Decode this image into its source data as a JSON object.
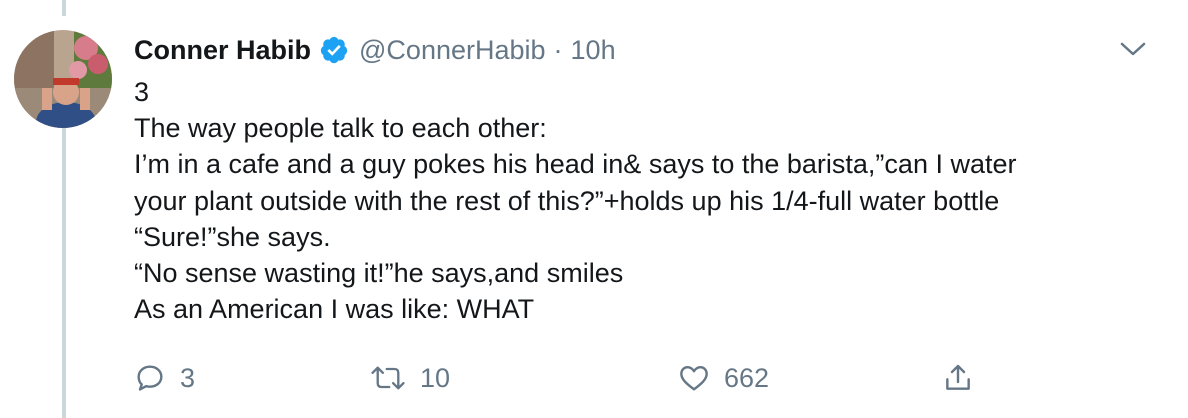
{
  "tweet": {
    "author": {
      "display_name": "Conner Habib",
      "handle": "@ConnerHabib",
      "verified": true
    },
    "separator": "·",
    "time": "10h",
    "text_lines": [
      "3",
      "The way people talk to each other:",
      "I’m in a cafe and a guy pokes his head in& says to the barista,”can I water",
      "your plant outside with the rest of this?”+holds up his 1/4-full water bottle",
      "“Sure!”she says.",
      "“No sense wasting it!”he says,and smiles",
      "As an American I was like: WHAT"
    ],
    "actions": {
      "reply": {
        "icon": "reply-icon",
        "count": "3"
      },
      "retweet": {
        "icon": "retweet-icon",
        "count": "10"
      },
      "like": {
        "icon": "heart-icon",
        "count": "662"
      },
      "share": {
        "icon": "share-icon"
      }
    }
  },
  "colors": {
    "primary_text": "#14171a",
    "secondary_text": "#657786",
    "verified_blue": "#1da1f2",
    "thread_line": "#ccd6dd"
  }
}
